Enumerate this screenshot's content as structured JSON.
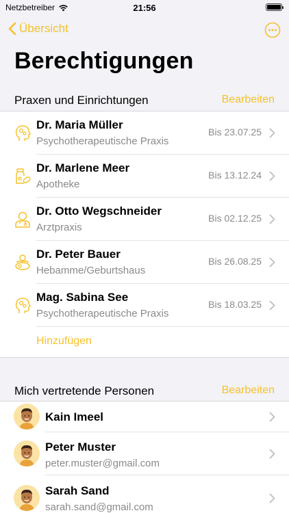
{
  "status_bar": {
    "carrier": "Netzbetreiber",
    "time": "21:56"
  },
  "nav": {
    "back_label": "Übersicht"
  },
  "page": {
    "title": "Berechtigungen"
  },
  "colors": {
    "accent": "#f6c12a",
    "secondary_text": "#8a8a8e",
    "background": "#f2f2f7"
  },
  "practices": {
    "title": "Praxen und Einrichtungen",
    "edit_label": "Bearbeiten",
    "add_label": "Hinzufügen",
    "items": [
      {
        "name": "Dr. Maria Müller",
        "type": "Psychotherapeutische Praxis",
        "until": "Bis 23.07.25",
        "icon": "head-gears-icon"
      },
      {
        "name": "Dr. Marlene Meer",
        "type": "Apotheke",
        "until": "Bis 13.12.24",
        "icon": "pharmacy-bottle-icon"
      },
      {
        "name": "Dr. Otto Wegschneider",
        "type": "Arztpraxis",
        "until": "Bis 02.12.25",
        "icon": "doctor-icon"
      },
      {
        "name": "Dr. Peter Bauer",
        "type": "Hebamme/Geburtshaus",
        "until": "Bis 26.08.25",
        "icon": "midwife-icon"
      },
      {
        "name": "Mag. Sabina See",
        "type": "Psychotherapeutische Praxis",
        "until": "Bis 18.03.25",
        "icon": "head-gears-icon"
      }
    ]
  },
  "representatives": {
    "title": "Mich vertretende Personen",
    "edit_label": "Bearbeiten",
    "items": [
      {
        "name": "Kain Imeel",
        "email": ""
      },
      {
        "name": "Peter Muster",
        "email": "peter.muster@gmail.com"
      },
      {
        "name": "Sarah Sand",
        "email": "sarah.sand@gmail.com"
      }
    ]
  }
}
